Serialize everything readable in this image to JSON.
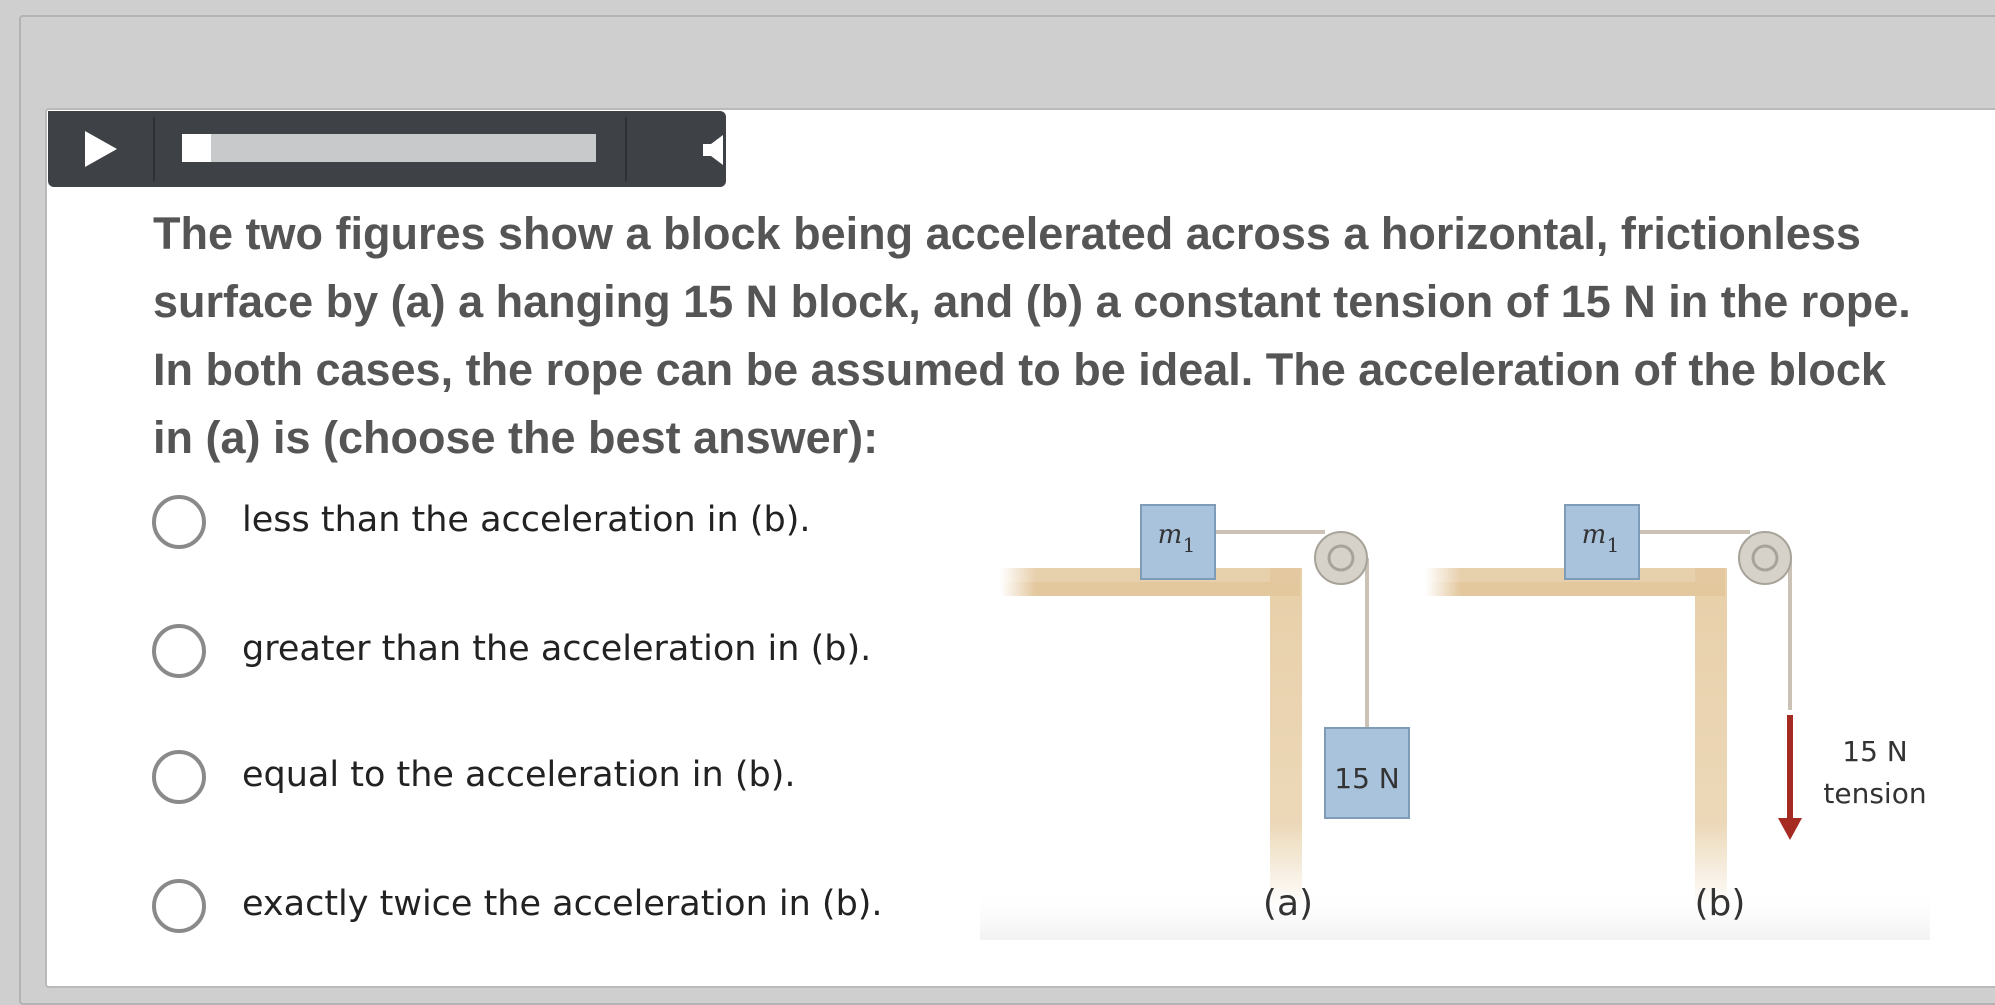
{
  "player": {
    "play_icon": "play-icon",
    "volume_icon": "volume-icon",
    "progress": 0.07
  },
  "question": {
    "text": "The two figures show a block being accelerated across a horizontal, frictionless surface by (a) a hanging 15 N block, and (b) a constant tension of 15 N in the rope. In both cases, the rope can be assumed to be ideal. The acceleration of the block in (a) is (choose the best answer):"
  },
  "options": [
    {
      "label": "less than the acceleration in (b)."
    },
    {
      "label": "greater than the acceleration in (b)."
    },
    {
      "label": "equal to the acceleration in (b)."
    },
    {
      "label": "exactly twice the acceleration in (b)."
    }
  ],
  "figure": {
    "block_mass_symbol": "m",
    "block_mass_subscript": "1",
    "hanging_block_label": "15 N",
    "tension_label_line1": "15 N",
    "tension_label_line2": "tension",
    "caption_a": "(a)",
    "caption_b": "(b)",
    "colors": {
      "block_fill": "#a9c3dc",
      "table_wood": "#e8cfa9",
      "arrow": "#a52a22",
      "rope": "#c9c2b5"
    }
  }
}
